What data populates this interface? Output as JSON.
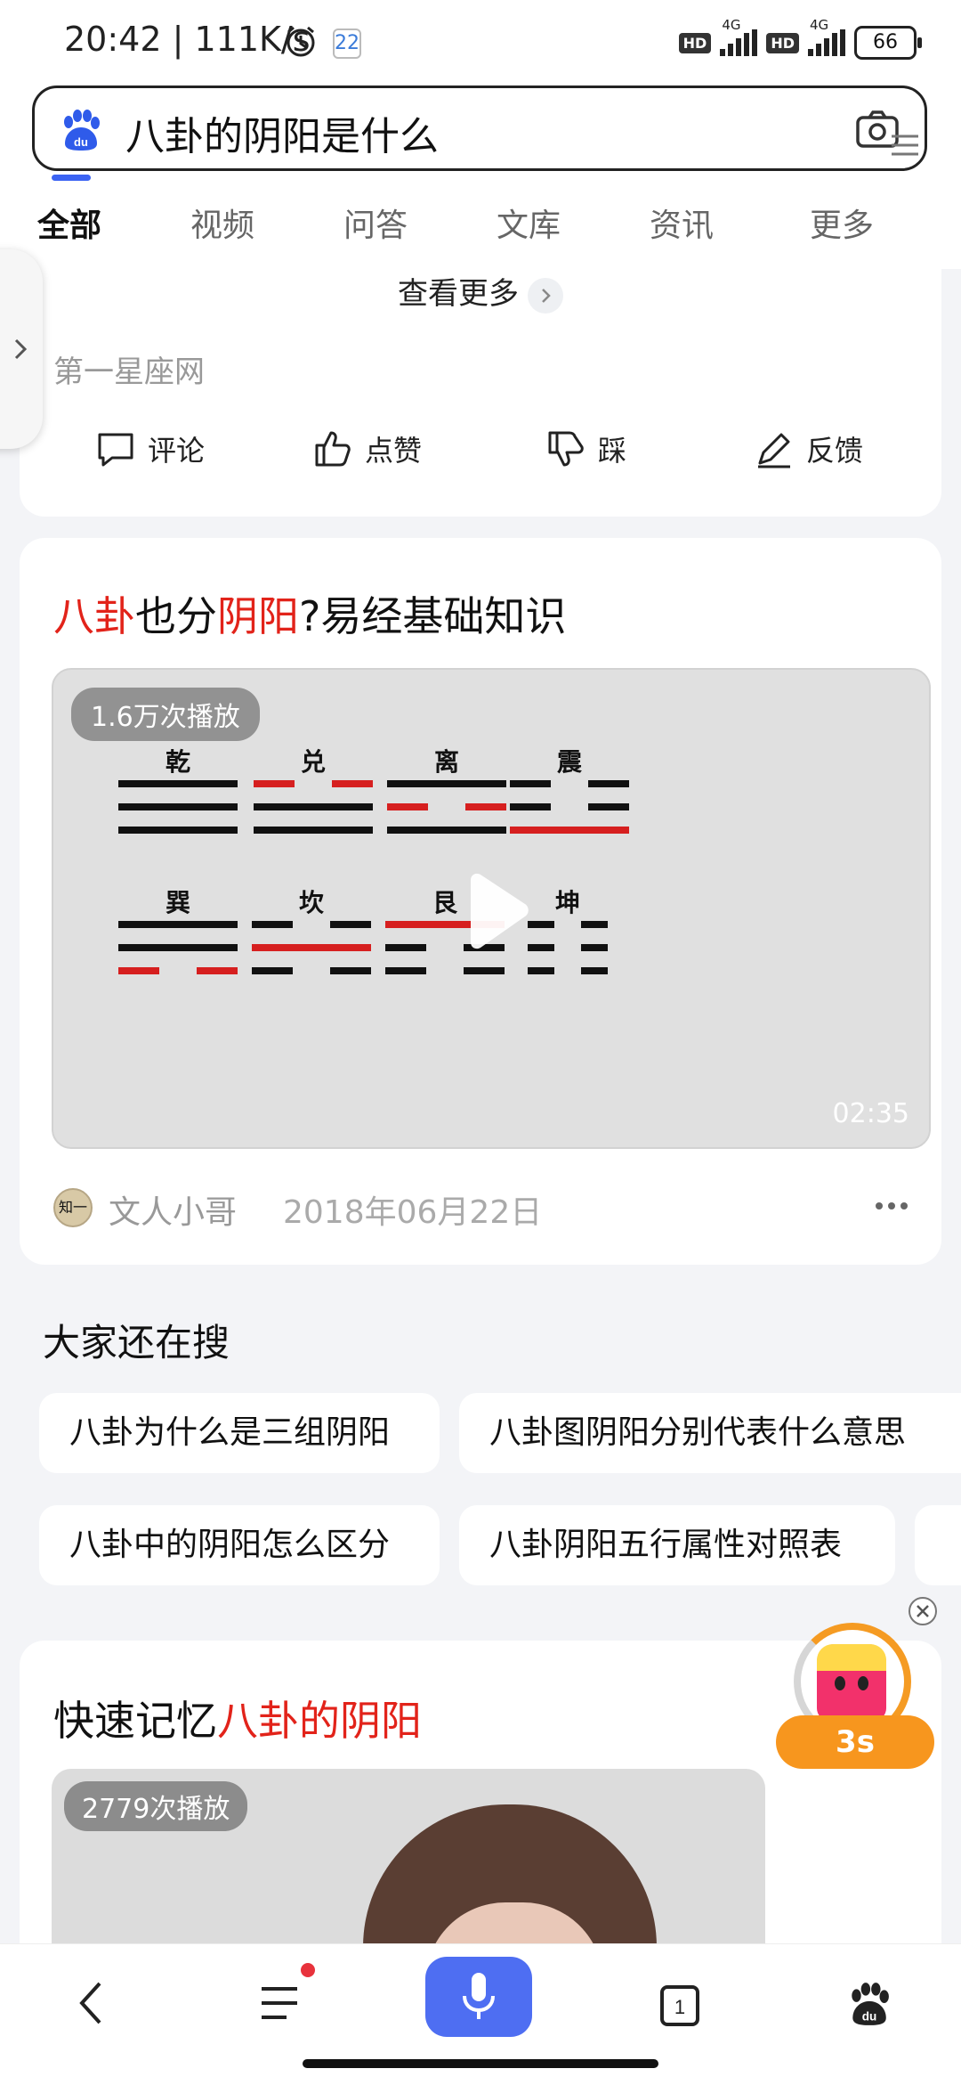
{
  "status_bar": {
    "time": "20:42",
    "speed": "111K/s",
    "calendar_day": "22",
    "network1": "4G",
    "network2": "4G",
    "hd": "HD",
    "battery": "66"
  },
  "search": {
    "query": "八卦的阴阳是什么"
  },
  "tabs": [
    {
      "label": "全部",
      "active": true
    },
    {
      "label": "视频"
    },
    {
      "label": "问答"
    },
    {
      "label": "文库"
    },
    {
      "label": "资讯"
    },
    {
      "label": "更多"
    }
  ],
  "card1": {
    "see_more": "查看更多",
    "source": "第一星座网",
    "actions": {
      "comment": "评论",
      "like": "点赞",
      "dislike": "踩",
      "feedback": "反馈"
    }
  },
  "card2": {
    "title_part1": "八卦",
    "title_part2": "也分",
    "title_part3": "阴阳",
    "title_part4": "?易经基础知识",
    "views": "1.6万次播放",
    "duration": "02:35",
    "author": "文人小哥",
    "date": "2018年06月22日",
    "avatar_text": "知一",
    "trigrams": [
      {
        "name": "乾"
      },
      {
        "name": "兑"
      },
      {
        "name": "离"
      },
      {
        "name": "震"
      },
      {
        "name": "巽"
      },
      {
        "name": "坎"
      },
      {
        "name": "艮"
      },
      {
        "name": "坤"
      }
    ]
  },
  "related": {
    "title": "大家还在搜",
    "items": [
      "八卦为什么是三组阴阳",
      "八卦图阴阳分别代表什么意思",
      "八卦中的阴阳怎么区分",
      "八卦阴阳五行属性对照表"
    ]
  },
  "card3": {
    "title_part1": "快速记忆",
    "title_part2": "八卦的阴阳",
    "views": "2779次播放"
  },
  "float_widget": {
    "countdown": "3s"
  },
  "colors": {
    "accent": "#4e6ef2",
    "highlight": "#e2231a",
    "float_orange": "#f7961e"
  }
}
